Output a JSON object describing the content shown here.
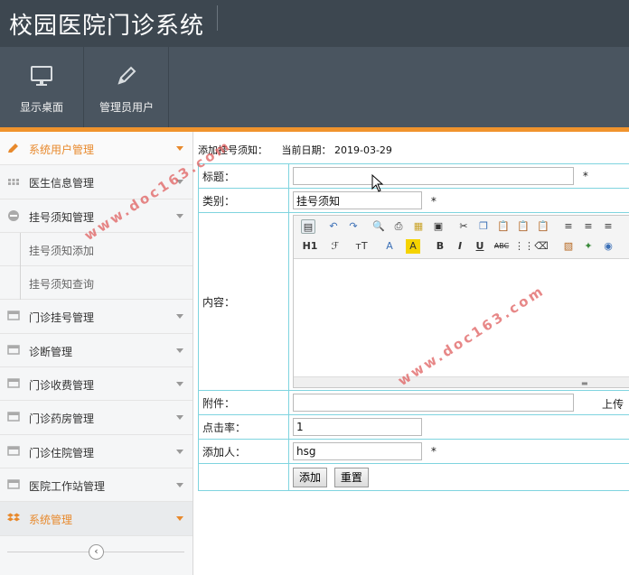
{
  "app": {
    "title": "校园医院门诊系统"
  },
  "toolbar": {
    "items": [
      {
        "label": "显示桌面",
        "icon": "monitor-icon"
      },
      {
        "label": "管理员用户",
        "icon": "pencil-icon"
      }
    ]
  },
  "sidebar": {
    "items": [
      {
        "label": "系统用户管理",
        "icon": "pencil-icon",
        "active": true
      },
      {
        "label": "医生信息管理",
        "icon": "grid-icon"
      },
      {
        "label": "挂号须知管理",
        "icon": "minus-circle-icon",
        "expanded": true
      },
      {
        "label": "门诊挂号管理",
        "icon": "window-icon"
      },
      {
        "label": "诊断管理",
        "icon": "window-icon"
      },
      {
        "label": "门诊收费管理",
        "icon": "window-icon"
      },
      {
        "label": "门诊药房管理",
        "icon": "window-icon"
      },
      {
        "label": "门诊住院管理",
        "icon": "window-icon"
      },
      {
        "label": "医院工作站管理",
        "icon": "window-icon"
      },
      {
        "label": "系统管理",
        "icon": "dropbox-icon",
        "highlighted": true
      }
    ],
    "subitems": [
      {
        "label": "挂号须知添加"
      },
      {
        "label": "挂号须知查询"
      }
    ],
    "collapse_icon": "chevron-left-icon"
  },
  "page": {
    "heading": "添加挂号须知：",
    "date_label": "当前日期：",
    "date": "2019-03-29"
  },
  "form": {
    "title_label": "标题：",
    "title_value": "",
    "category_label": "类别：",
    "category_value": "挂号须知",
    "content_label": "内容：",
    "attachment_label": "附件：",
    "attachment_value": "",
    "upload_label": "上传",
    "clicks_label": "点击率：",
    "clicks_value": "1",
    "adder_label": "添加人：",
    "adder_value": "hsg",
    "required_mark": "*",
    "submit_label": "添加",
    "reset_label": "重置"
  },
  "editor": {
    "row1": [
      "source-icon",
      "undo-icon",
      "redo-icon",
      "preview-icon",
      "print-icon",
      "template-icon",
      "cut-icon",
      "copy-icon",
      "paste-icon",
      "paste-text-icon",
      "paste-word-icon",
      "align-left-icon",
      "align-center-icon",
      "align-right-icon"
    ],
    "row2": [
      "heading-icon",
      "font-family-icon",
      "font-size-icon",
      "font-color-icon",
      "highlight-icon",
      "bold-icon",
      "italic-icon",
      "underline-icon",
      "strikethrough-icon",
      "line-height-icon",
      "remove-format-icon",
      "image-icon",
      "flash-icon",
      "media-icon"
    ],
    "row2_glyphs": {
      "heading": "H1",
      "font_family": "ℱ",
      "font_size": "тT",
      "font_color": "A",
      "highlight": "A",
      "bold": "B",
      "italic": "I",
      "underline": "U",
      "strike": "ABC"
    }
  },
  "watermark": {
    "text": "www.doc163.com"
  },
  "colors": {
    "topbar": "#3d4750",
    "toolbar": "#4a5560",
    "accent": "#f0932d",
    "border": "#7fd4df"
  }
}
